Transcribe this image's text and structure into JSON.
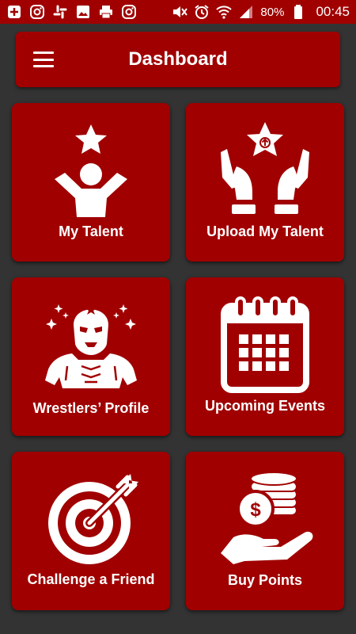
{
  "status_bar": {
    "battery_percent": "80%",
    "time": "00:45",
    "icons": [
      "add-box-icon",
      "instagram-icon",
      "slack-icon",
      "image-icon",
      "printer-icon",
      "instagram-icon",
      "mute-icon",
      "alarm-icon",
      "wifi-icon",
      "signal-icon",
      "battery-icon"
    ]
  },
  "app_bar": {
    "title": "Dashboard",
    "menu_icon": "hamburger-menu-icon"
  },
  "cards": [
    {
      "label": "My Talent",
      "icon": "star-person-icon"
    },
    {
      "label": "Upload My Talent",
      "icon": "hands-star-upload-icon"
    },
    {
      "label": "Wrestlers’ Profile",
      "icon": "wrestler-mask-icon"
    },
    {
      "label": "Upcoming Events",
      "icon": "calendar-icon"
    },
    {
      "label": "Challenge a Friend",
      "icon": "target-arrow-icon"
    },
    {
      "label": "Buy Points",
      "icon": "coins-hand-icon"
    }
  ],
  "colors": {
    "primary": "#a00000",
    "background": "#333333",
    "icon": "#ffffff"
  }
}
